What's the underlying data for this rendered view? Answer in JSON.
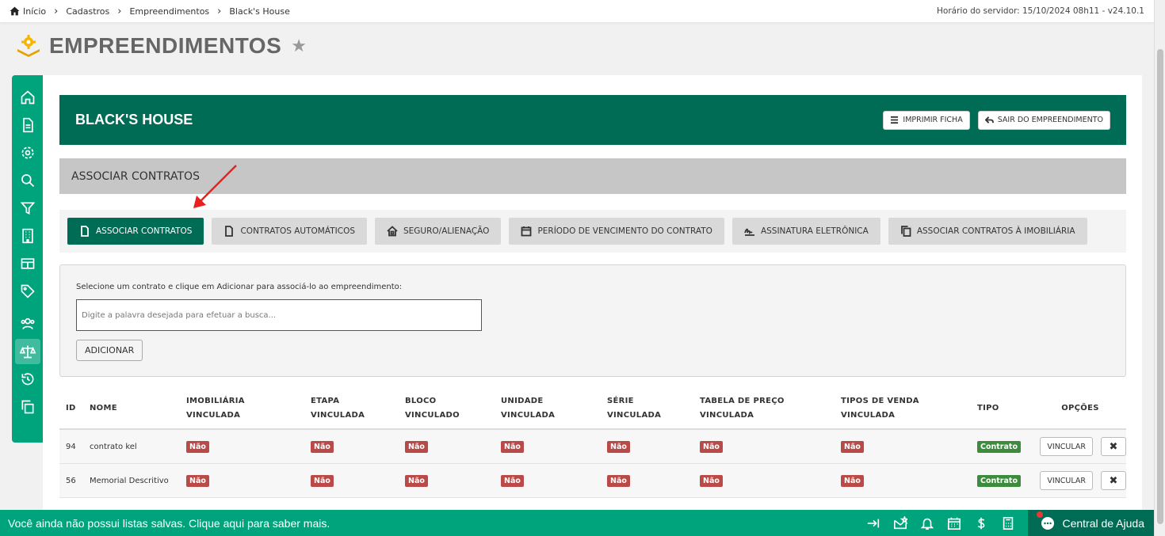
{
  "breadcrumb": {
    "items": [
      "Início",
      "Cadastros",
      "Empreendimentos",
      "Black's House"
    ]
  },
  "server_info": "Horário do servidor: 15/10/2024 08h11 - v24.10.1",
  "page": {
    "title": "EMPREENDIMENTOS"
  },
  "sidebar": {
    "icons": [
      "home-icon",
      "document-icon",
      "gear-icon",
      "search-icon",
      "filter-icon",
      "building-icon",
      "table-icon",
      "tag-icon",
      "users-icon",
      "scale-icon",
      "history-icon",
      "copy-icon"
    ]
  },
  "header": {
    "title": "BLACK'S HOUSE",
    "print_label": "IMPRIMIR FICHA",
    "exit_label": "SAIR DO EMPREENDIMENTO"
  },
  "section": {
    "title": "ASSOCIAR CONTRATOS"
  },
  "tabs": [
    {
      "label": "ASSOCIAR CONTRATOS",
      "icon": "document-icon",
      "active": true
    },
    {
      "label": "CONTRATOS AUTOMÁTICOS",
      "icon": "document-icon",
      "active": false
    },
    {
      "label": "SEGURO/ALIENAÇÃO",
      "icon": "house-icon",
      "active": false
    },
    {
      "label": "PERÍODO DE VENCIMENTO DO CONTRATO",
      "icon": "calendar-icon",
      "active": false
    },
    {
      "label": "ASSINATURA ELETRÔNICA",
      "icon": "signature-icon",
      "active": false
    },
    {
      "label": "ASSOCIAR CONTRATOS À IMOBILIÁRIA",
      "icon": "copy-icon",
      "active": false
    }
  ],
  "search": {
    "instruction": "Selecione um contrato e clique em Adicionar para associá-lo ao empreendimento:",
    "placeholder": "Digite a palavra desejada para efetuar a busca...",
    "add_label": "ADICIONAR"
  },
  "table": {
    "headers": {
      "id": "ID",
      "nome": "NOME",
      "imob": [
        "IMOBILIÁRIA",
        "VINCULADA"
      ],
      "etapa": [
        "ETAPA",
        "VINCULADA"
      ],
      "bloco": [
        "BLOCO",
        "VINCULADO"
      ],
      "unid": [
        "UNIDADE",
        "VINCULADA"
      ],
      "serie": [
        "SÉRIE",
        "VINCULADA"
      ],
      "tab": [
        "TABELA DE PREÇO",
        "VINCULADA"
      ],
      "tipos": [
        "TIPOS DE VENDA",
        "VINCULADA"
      ],
      "tipo": "TIPO",
      "opcoes": "OPÇÕES"
    },
    "rows": [
      {
        "id": "94",
        "nome": "contrato kel",
        "imob": "Não",
        "etapa": "Não",
        "bloco": "Não",
        "unid": "Não",
        "serie": "Não",
        "tab": "Não",
        "tipos": "Não",
        "tipo": "Contrato",
        "link_label": "VINCULAR"
      },
      {
        "id": "56",
        "nome": "Memorial Descritivo",
        "imob": "Não",
        "etapa": "Não",
        "bloco": "Não",
        "unid": "Não",
        "serie": "Não",
        "tab": "Não",
        "tipos": "Não",
        "tipo": "Contrato",
        "link_label": "VINCULAR"
      }
    ]
  },
  "bottombar": {
    "message": "Você ainda não possui listas salvas. Clique aqui para saber mais.",
    "help_label": "Central de Ajuda"
  },
  "colors": {
    "brand_dark": "#006c55",
    "brand_light": "#00a47c",
    "badge_no": "#b94a48",
    "badge_contract": "#3d8b3d"
  }
}
